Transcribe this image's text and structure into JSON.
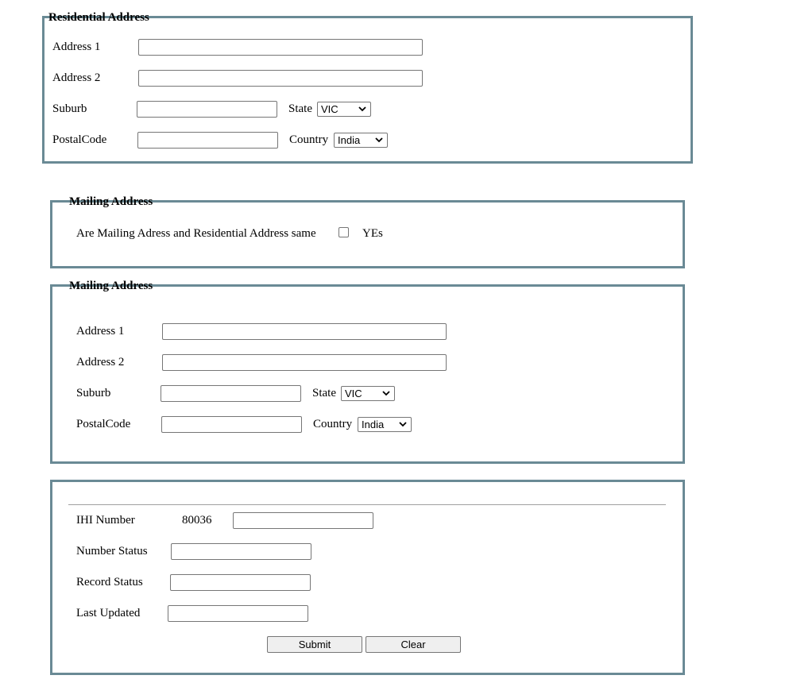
{
  "residential": {
    "legend": "Residential Address",
    "address1_label": "Address 1",
    "address1_value": "",
    "address2_label": "Address 2",
    "address2_value": "",
    "suburb_label": "Suburb",
    "suburb_value": "",
    "state_label": "State",
    "state_value": "VIC",
    "postal_label": "PostalCode",
    "postal_value": "",
    "country_label": "Country",
    "country_value": "India"
  },
  "mailing_same": {
    "legend": "Mailing Address",
    "question": "Are Mailing Adress and Residential Address same",
    "checked": false,
    "yes_label": "YEs"
  },
  "mailing": {
    "legend": "Mailing Address",
    "address1_label": "Address 1",
    "address1_value": "",
    "address2_label": "Address 2",
    "address2_value": "",
    "suburb_label": "Suburb",
    "suburb_value": "",
    "state_label": "State",
    "state_value": "VIC",
    "postal_label": "PostalCode",
    "postal_value": "",
    "country_label": "Country",
    "country_value": "India"
  },
  "ihi": {
    "ihi_label": "IHI Number",
    "ihi_prefix": "80036",
    "ihi_value": "",
    "number_status_label": "Number Status",
    "number_status_value": "",
    "record_status_label": "Record Status",
    "record_status_value": "",
    "last_updated_label": "Last Updated",
    "last_updated_value": "",
    "submit_label": "Submit",
    "clear_label": "Clear"
  },
  "colors": {
    "border": "#6a8a95",
    "button_bg": "#efefef"
  }
}
